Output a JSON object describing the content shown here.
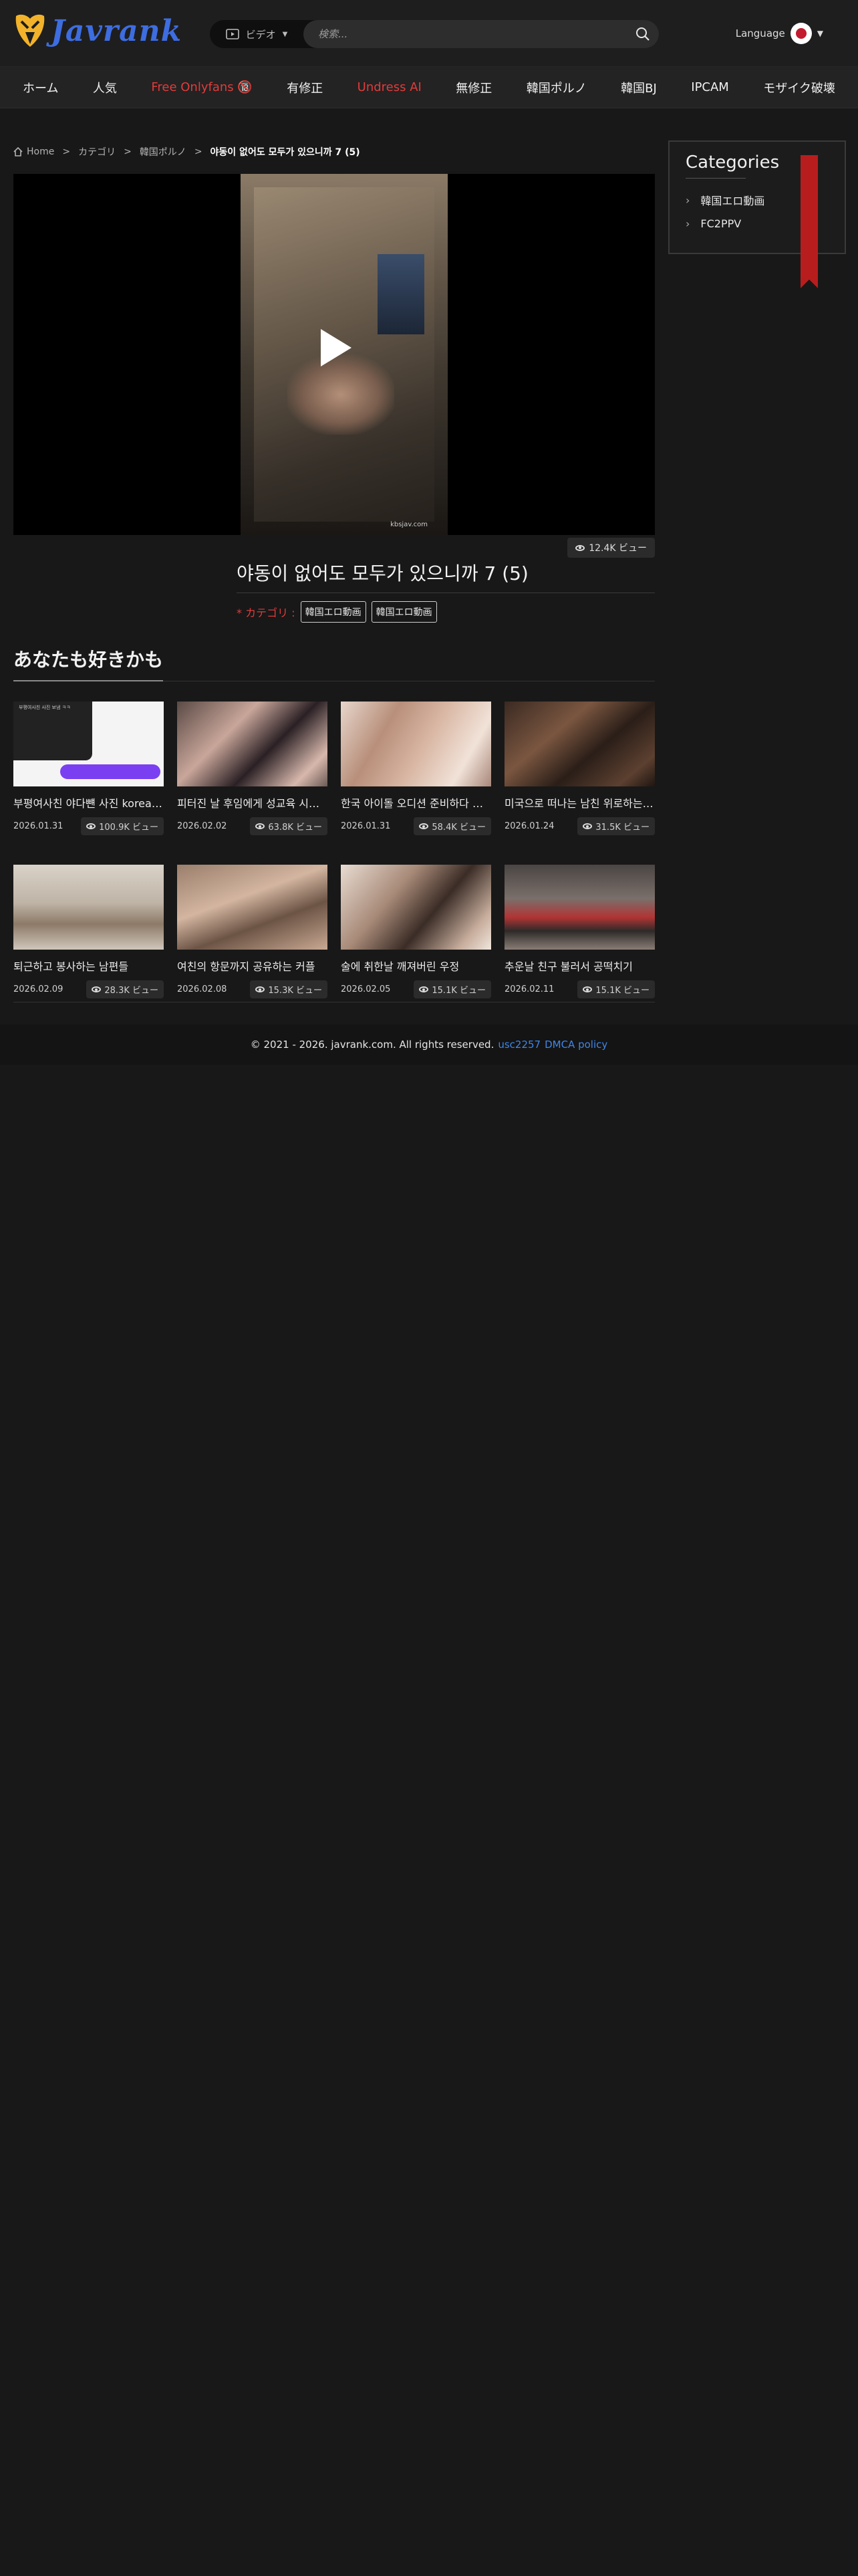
{
  "header": {
    "logo_text": "Javrank",
    "search_type_label": "ビデオ",
    "search_placeholder": "検索...",
    "language_label": "Language"
  },
  "nav": {
    "items": [
      {
        "label": "ホーム",
        "color": "#f0f0f0"
      },
      {
        "label": "人気",
        "color": "#f0f0f0"
      },
      {
        "label": "Free Onlyfans 🔞",
        "color": "#e23b3b"
      },
      {
        "label": "有修正",
        "color": "#f0f0f0"
      },
      {
        "label": "Undress AI",
        "color": "#e23b3b"
      },
      {
        "label": "無修正",
        "color": "#f0f0f0"
      },
      {
        "label": "韓国ポルノ",
        "color": "#f0f0f0"
      },
      {
        "label": "韓国BJ",
        "color": "#f0f0f0"
      },
      {
        "label": "IPCAM",
        "color": "#f0f0f0"
      },
      {
        "label": "モザイク破壊",
        "color": "#f0f0f0"
      }
    ]
  },
  "breadcrumb": {
    "home": "Home",
    "sep": ">",
    "category": "カテゴリ",
    "subcategory": "韓国ポルノ",
    "current": "야동이 없어도 모두가 있으니까 7 (5)"
  },
  "video": {
    "watermark": "kbsjav.com",
    "views": "12.4K ビュー",
    "title": "야동이 없어도 모두가 있으니까 7 (5)",
    "category_label": "* カテゴリ :",
    "tags": [
      "韓国エロ動画",
      "韓国エロ動画"
    ]
  },
  "related": {
    "heading": "あなたも好きかも",
    "thumb_overlay_text": "부평여사친 사진 보냄 ㅋㅋ",
    "items": [
      {
        "title": "부평여사친 야다뺸 사진 korean BJ",
        "date": "2026.01.31",
        "views": "100.9K ビュー"
      },
      {
        "title": "피터진 날 후임에게 성교육 시키는 선배",
        "date": "2026.02.02",
        "views": "63.8K ビュー"
      },
      {
        "title": "한국 아이돌 오디션 준비하다 매니저",
        "date": "2026.01.31",
        "views": "58.4K ビュー"
      },
      {
        "title": "미국으로 떠나는 남친 위로하는 여친",
        "date": "2026.01.24",
        "views": "31.5K ビュー"
      },
      {
        "title": "퇴근하고 봉사하는 남편들",
        "date": "2026.02.09",
        "views": "28.3K ビュー"
      },
      {
        "title": "여친의 항문까지 공유하는 커플",
        "date": "2026.02.08",
        "views": "15.3K ビュー"
      },
      {
        "title": "술에 취한날 깨져버린 우정",
        "date": "2026.02.05",
        "views": "15.1K ビュー"
      },
      {
        "title": "추운날 친구 불러서 공떡치기",
        "date": "2026.02.11",
        "views": "15.1K ビュー"
      }
    ]
  },
  "sidebar": {
    "title": "Categories",
    "items": [
      "韓国エロ動画",
      "FC2PPV"
    ]
  },
  "footer": {
    "copyright": "© 2021 - 2026. javrank.com. All rights reserved.",
    "link_usc": "usc2257",
    "link_dmca": "DMCA policy"
  },
  "colors": {
    "background": "#181818",
    "accent_red": "#e23b3b",
    "link_blue": "#3f86e8",
    "logo_blue": "#3d6de0",
    "ribbon": "#b81d1d"
  }
}
